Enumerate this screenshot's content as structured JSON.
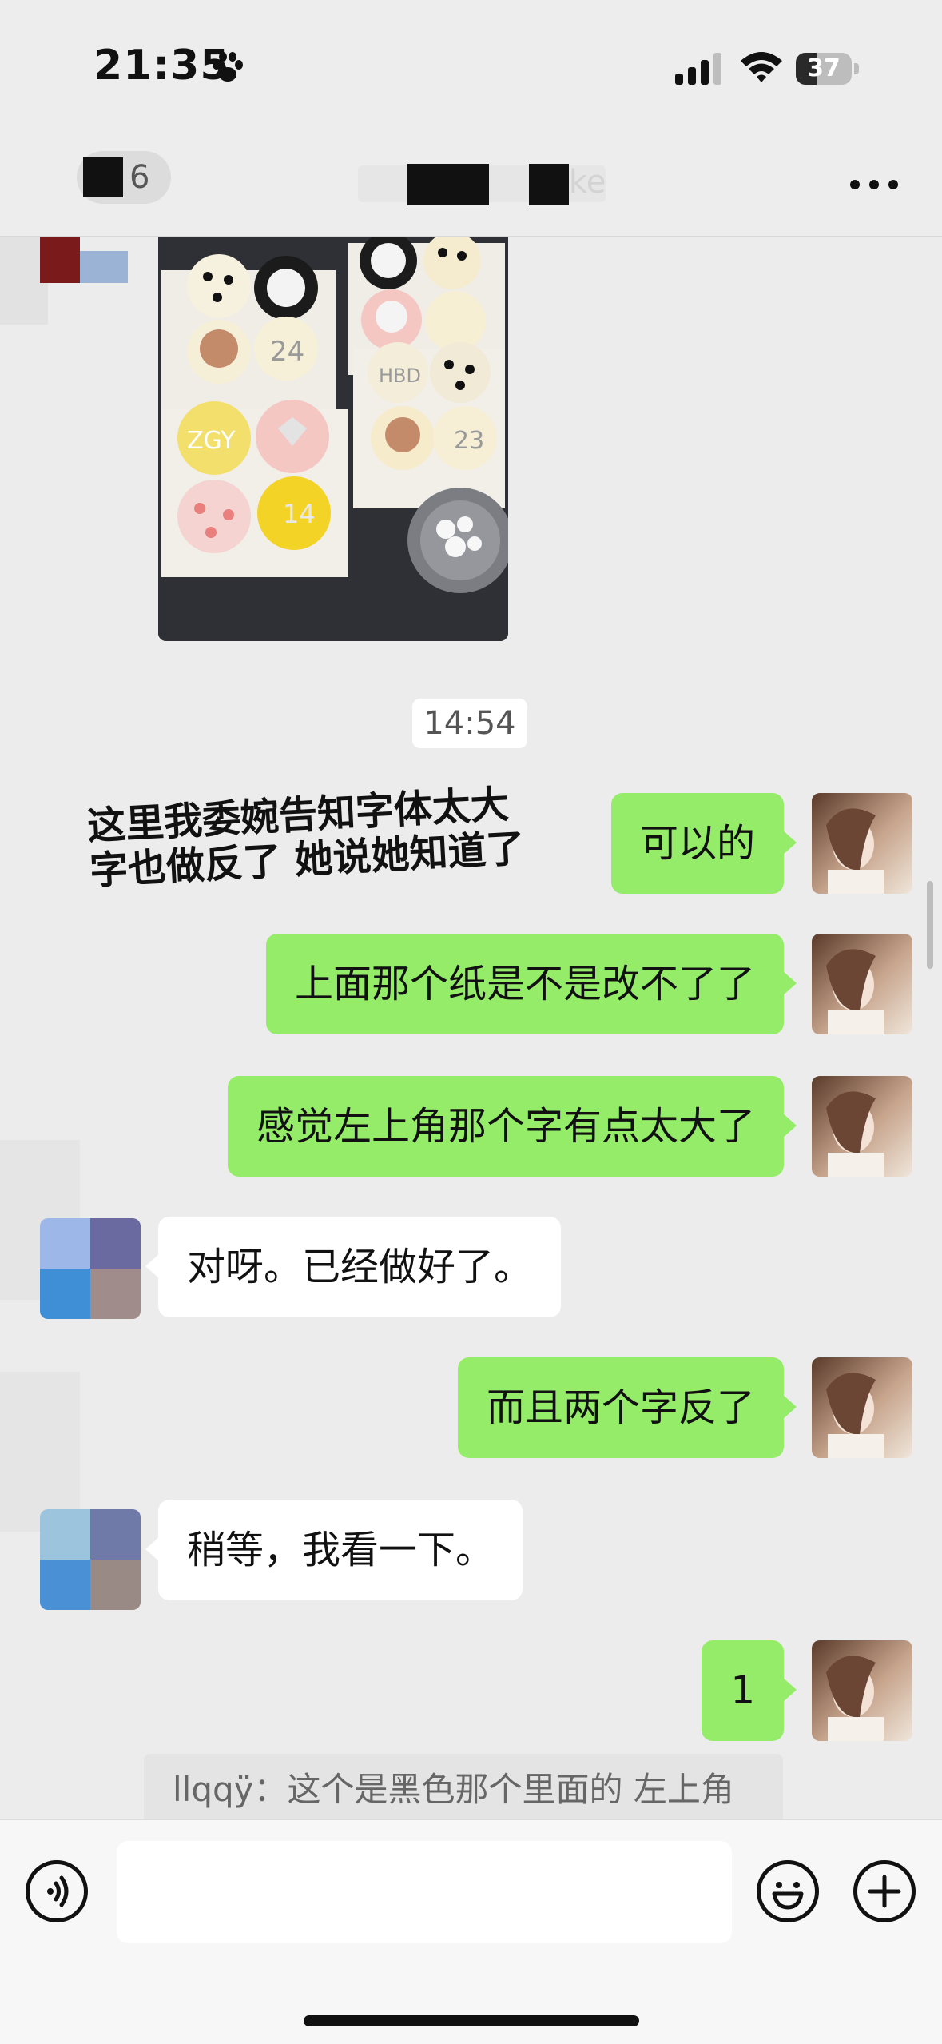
{
  "status_bar": {
    "time": "21:35",
    "battery_level": "37",
    "battery_fraction": 0.37
  },
  "nav": {
    "back_count": "6",
    "title_fragment": "ke"
  },
  "chat": {
    "timestamp": "14:54",
    "overlay_note_line1": "这里我委婉告知字体太大",
    "overlay_note_line2": "字也做反了 她说她知道了",
    "messages": [
      {
        "side": "me",
        "text": "可以的"
      },
      {
        "side": "me",
        "text": "上面那个纸是不是改不了了"
      },
      {
        "side": "me",
        "text": "感觉左上角那个字有点太大了"
      },
      {
        "side": "them",
        "text": "对呀。已经做好了。"
      },
      {
        "side": "me",
        "text": "而且两个字反了"
      },
      {
        "side": "them",
        "text": "稍等，我看一下。"
      },
      {
        "side": "me",
        "text": "1"
      }
    ],
    "quote_reply": "llqqÿ：这个是黑色那个里面的 左上角"
  },
  "input": {
    "placeholder": ""
  },
  "colors": {
    "my_bubble": "#95ec69",
    "their_bubble": "#ffffff",
    "chat_background": "#ececec"
  },
  "icons": [
    "paw-icon",
    "signal-icon",
    "wifi-icon",
    "battery-icon",
    "more-icon",
    "voice-icon",
    "emoji-icon",
    "plus-icon"
  ]
}
